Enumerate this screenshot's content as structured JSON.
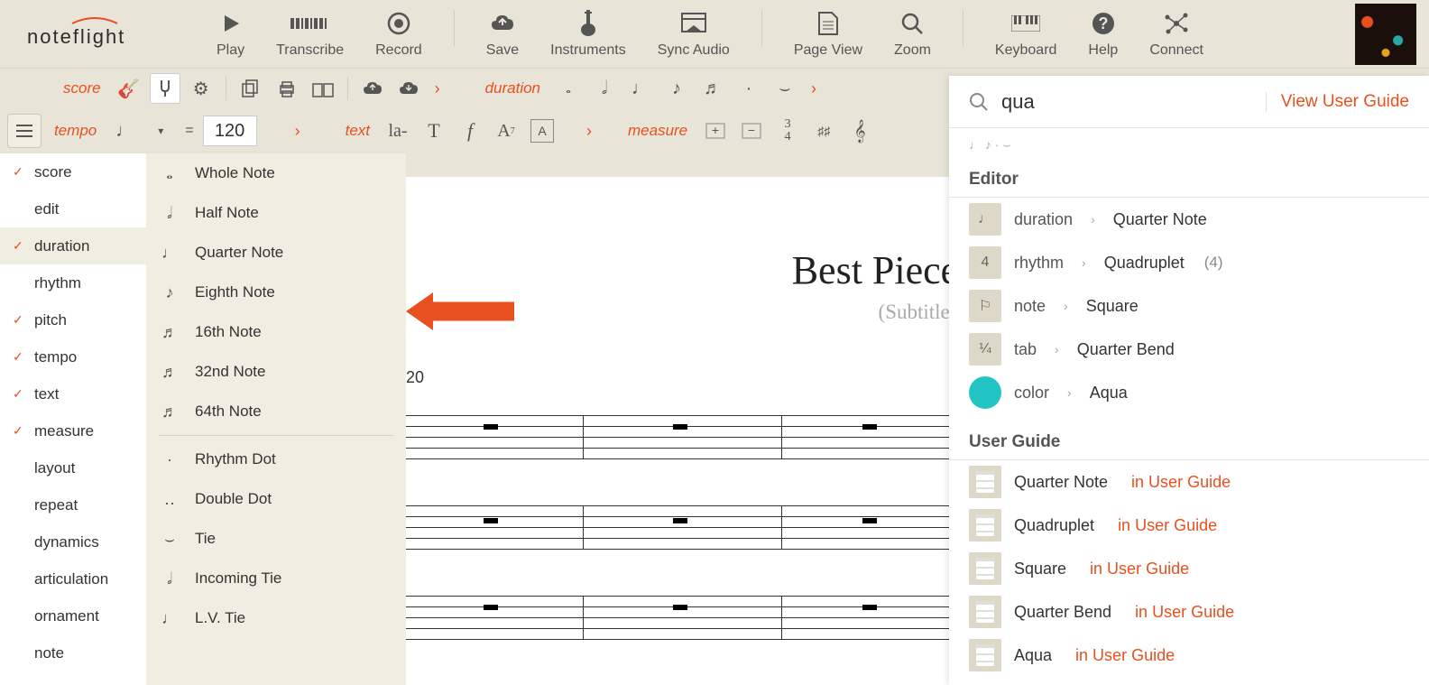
{
  "brand": "noteflight",
  "top_toolbar": [
    {
      "label": "Play"
    },
    {
      "label": "Transcribe"
    },
    {
      "label": "Record"
    },
    {
      "label": "Save"
    },
    {
      "label": "Instruments"
    },
    {
      "label": "Sync Audio"
    },
    {
      "label": "Page View"
    },
    {
      "label": "Zoom"
    },
    {
      "label": "Keyboard"
    },
    {
      "label": "Help"
    },
    {
      "label": "Connect"
    }
  ],
  "second_row": {
    "score_label": "score",
    "duration_label": "duration"
  },
  "third_row": {
    "tempo_label": "tempo",
    "tempo_value": "120",
    "text_label": "text",
    "measure_label": "measure"
  },
  "categories": [
    {
      "label": "score",
      "checked": true,
      "active": false
    },
    {
      "label": "edit",
      "checked": false,
      "active": false
    },
    {
      "label": "duration",
      "checked": true,
      "active": true
    },
    {
      "label": "rhythm",
      "checked": false,
      "active": false
    },
    {
      "label": "pitch",
      "checked": true,
      "active": false
    },
    {
      "label": "tempo",
      "checked": true,
      "active": false
    },
    {
      "label": "text",
      "checked": true,
      "active": false
    },
    {
      "label": "measure",
      "checked": true,
      "active": false
    },
    {
      "label": "layout",
      "checked": false,
      "active": false
    },
    {
      "label": "repeat",
      "checked": false,
      "active": false
    },
    {
      "label": "dynamics",
      "checked": false,
      "active": false
    },
    {
      "label": "articulation",
      "checked": false,
      "active": false
    },
    {
      "label": "ornament",
      "checked": false,
      "active": false
    },
    {
      "label": "note",
      "checked": false,
      "active": false
    }
  ],
  "duration_menu": {
    "group1": [
      {
        "icon": "𝅝",
        "label": "Whole Note"
      },
      {
        "icon": "𝅗𝅥",
        "label": "Half Note"
      },
      {
        "icon": "♩",
        "label": "Quarter Note"
      },
      {
        "icon": "♪",
        "label": "Eighth Note"
      },
      {
        "icon": "♬",
        "label": "16th Note"
      },
      {
        "icon": "♬",
        "label": "32nd Note"
      },
      {
        "icon": "♬",
        "label": "64th Note"
      }
    ],
    "group2": [
      {
        "icon": "·",
        "label": "Rhythm Dot"
      },
      {
        "icon": "‥",
        "label": "Double Dot"
      },
      {
        "icon": "⌣",
        "label": "Tie"
      },
      {
        "icon": "𝅗𝅥",
        "label": "Incoming Tie"
      },
      {
        "icon": "♩",
        "label": "L.V. Tie"
      }
    ]
  },
  "score": {
    "title": "Best Piece Ever",
    "subtitle": "(Subtitle)",
    "tempo_indicator": "20"
  },
  "search": {
    "query": "qua",
    "view_guide": "View User Guide",
    "editor_header": "Editor",
    "editor_results": [
      {
        "icon": "♩",
        "category": "duration",
        "value": "Quarter Note",
        "extra": ""
      },
      {
        "icon": "4",
        "category": "rhythm",
        "value": "Quadruplet",
        "extra": "(4)"
      },
      {
        "icon": "⚐",
        "category": "note",
        "value": "Square",
        "extra": ""
      },
      {
        "icon": "¼",
        "category": "tab",
        "value": "Quarter Bend",
        "extra": ""
      },
      {
        "icon": "",
        "icon_class": "aqua",
        "category": "color",
        "value": "Aqua",
        "extra": ""
      }
    ],
    "guide_header": "User Guide",
    "guide_results": [
      {
        "title": "Quarter Note",
        "suffix": "in User Guide"
      },
      {
        "title": "Quadruplet",
        "suffix": "in User Guide"
      },
      {
        "title": "Square",
        "suffix": "in User Guide"
      },
      {
        "title": "Quarter Bend",
        "suffix": "in User Guide"
      },
      {
        "title": "Aqua",
        "suffix": "in User Guide"
      }
    ]
  }
}
